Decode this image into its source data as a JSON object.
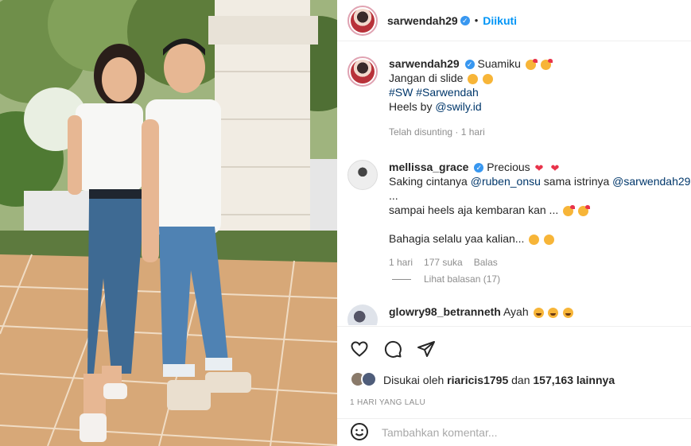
{
  "post": {
    "username": "sarwendah29",
    "follow_label": "Diikuti"
  },
  "caption": {
    "username": "sarwendah29",
    "line1": "Suamiku",
    "line2": "Jangan di slide",
    "hashtag1": "#SW",
    "hashtag2": "#Sarwendah",
    "line4_prefix": "Heels by",
    "line4_tag": "@swily.id",
    "meta": "Telah disunting · 1 hari"
  },
  "comments": [
    {
      "username": "mellissa_grace",
      "text1": "Precious",
      "text2_a": "Saking cintanya",
      "text2_tag1": "@ruben_onsu",
      "text2_b": "sama istrinya",
      "text2_tag2": "@sarwendah29",
      "text2_c": "...",
      "text3": "sampai heels aja kembaran kan ...",
      "text4": "Bahagia selalu yaa kalian...",
      "time": "1 hari",
      "likes": "177 suka",
      "reply": "Balas",
      "view_replies": "Lihat balasan (17)"
    },
    {
      "username": "glowry98_betranneth",
      "text1": "Ayah"
    }
  ],
  "actions": {
    "liked_by_prefix": "Disukai oleh",
    "liked_by_user": "riaricis1795",
    "liked_by_mid": "dan",
    "liked_by_count": "157,163 lainnya",
    "time_ago": "1 HARI YANG LALU"
  },
  "composer": {
    "placeholder": "Tambahkan komentar..."
  },
  "colors": {
    "link": "#00376b",
    "accent": "#0095f6",
    "muted": "#8e8e8e"
  },
  "icons": [
    "verified-badge-icon",
    "heart-icon",
    "comment-icon",
    "share-icon",
    "smiley-icon"
  ]
}
